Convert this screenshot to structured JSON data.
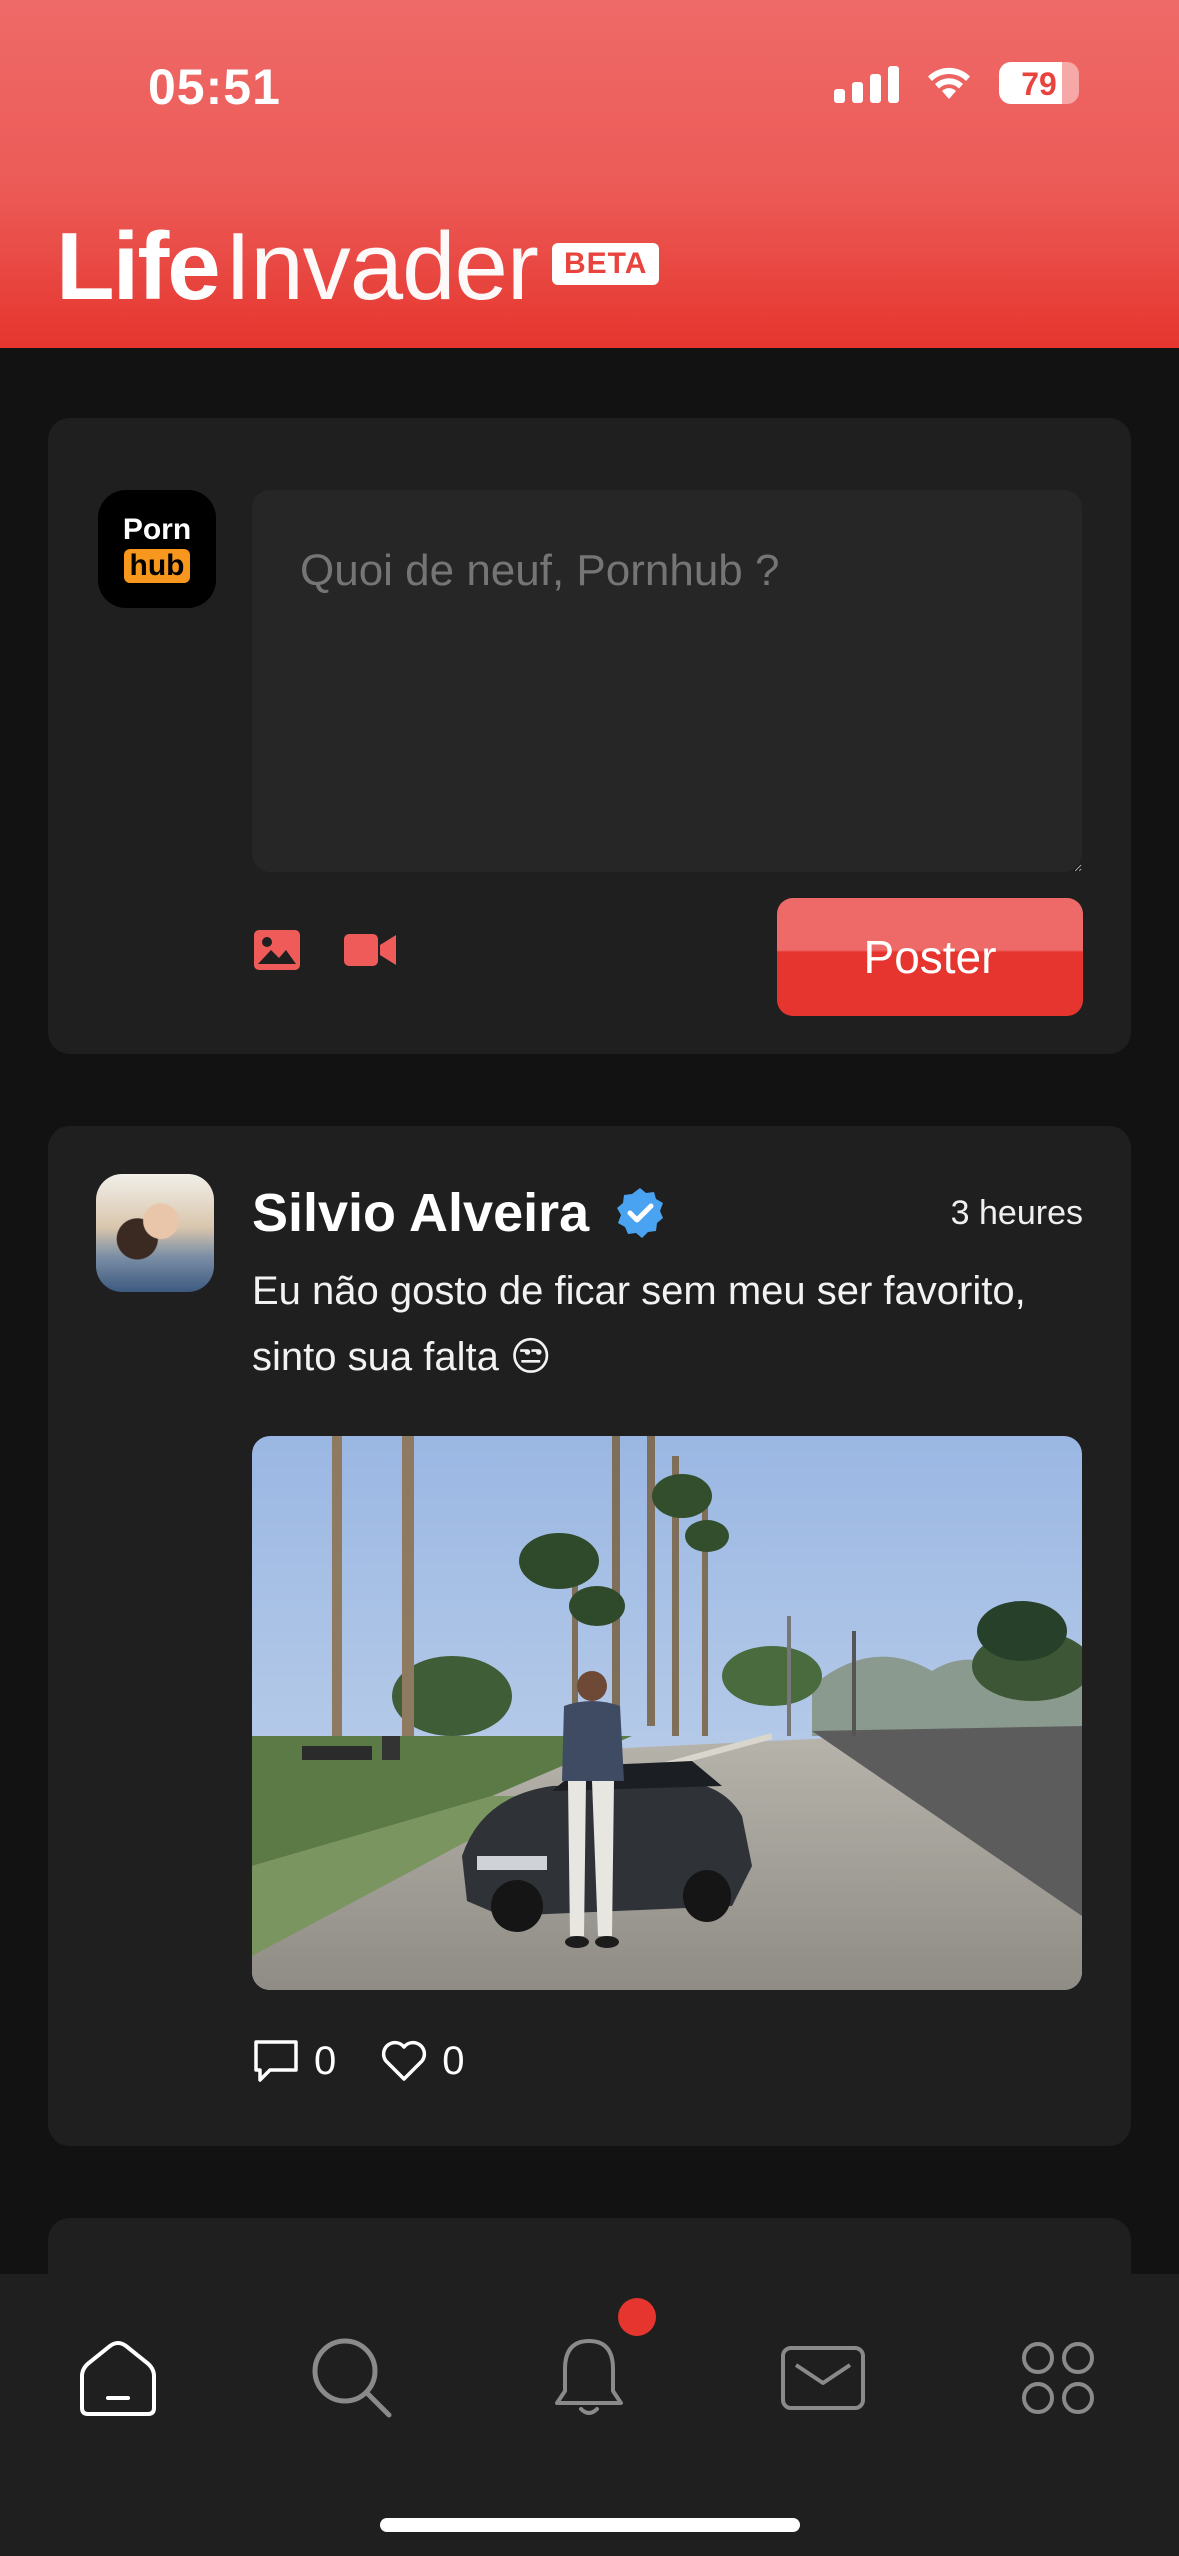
{
  "status_bar": {
    "time": "05:51",
    "battery": "79",
    "battery_level": 0.79
  },
  "header": {
    "logo_part1": "Life",
    "logo_part2": "Invader",
    "badge": "BETA",
    "colors": {
      "accent": "#e6352e",
      "accent_light": "#ee6a68"
    }
  },
  "compose": {
    "avatar_line1": "Porn",
    "avatar_line2": "hub",
    "placeholder": "Quoi de neuf, Pornhub ?",
    "image_icon": "image-icon",
    "video_icon": "video-camera-icon",
    "post_button": "Poster"
  },
  "post": {
    "author": "Silvio Alveira",
    "verified_icon": "verified-badge-icon",
    "time": "3 heures",
    "text": "Eu não gosto de ficar sem meu ser favorito, sinto sua falta 😒",
    "comments": "0",
    "likes": "0"
  },
  "tabbar": {
    "items": [
      {
        "icon": "home-icon",
        "active": true
      },
      {
        "icon": "search-icon"
      },
      {
        "icon": "bell-icon",
        "has_badge": true
      },
      {
        "icon": "mail-icon"
      },
      {
        "icon": "apps-grid-icon"
      }
    ]
  }
}
